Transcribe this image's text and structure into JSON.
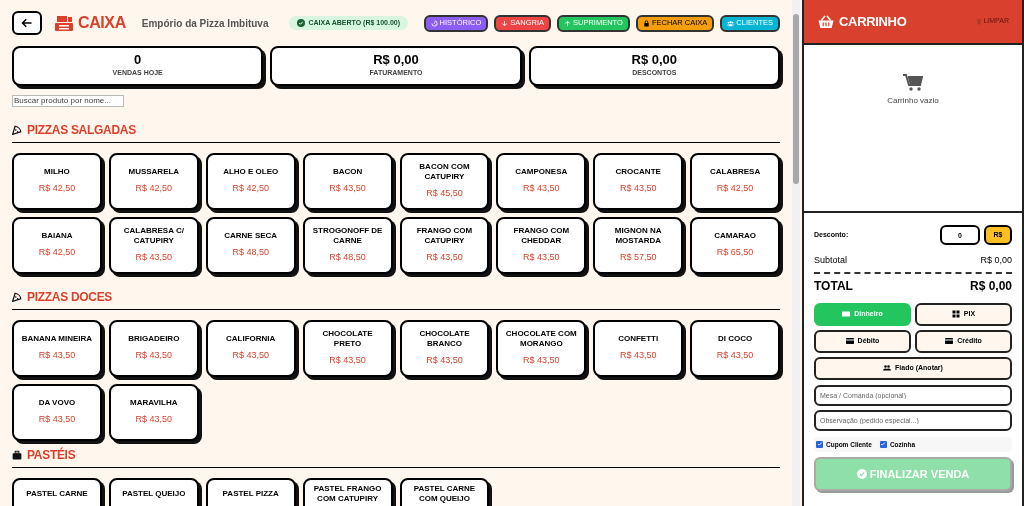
{
  "header": {
    "logo": "CAIXA",
    "store_name": "Empório da Pizza Imbituva",
    "status_badge": "CAIXA ABERTO (R$ 100.00)",
    "buttons": [
      {
        "label": "HISTÓRICO",
        "kind": "history",
        "color": "#8b5cf6"
      },
      {
        "label": "SANGRIA",
        "kind": "down",
        "color": "#ef4444"
      },
      {
        "label": "SUPRIMENTO",
        "kind": "up",
        "color": "#22c55e"
      },
      {
        "label": "FECHAR CAIXA",
        "kind": "lock",
        "color": "#f59e0b"
      },
      {
        "label": "CLIENTES",
        "kind": "users",
        "color": "#06b6d4"
      }
    ]
  },
  "stats": [
    {
      "value": "0",
      "label": "VENDAS HOJE"
    },
    {
      "value": "R$ 0,00",
      "label": "FATURAMENTO"
    },
    {
      "value": "R$ 0,00",
      "label": "DESCONTOS"
    }
  ],
  "search": {
    "placeholder": "Buscar produto por nome..."
  },
  "categories": [
    {
      "title": "PIZZAS SALGADAS",
      "kind": "slice",
      "products": [
        {
          "name": "MILHO",
          "price": "R$ 42,50"
        },
        {
          "name": "MUSSARELA",
          "price": "R$ 42,50"
        },
        {
          "name": "ALHO E OLEO",
          "price": "R$ 42,50"
        },
        {
          "name": "BACON",
          "price": "R$ 43,50"
        },
        {
          "name": "BACON COM CATUPIRY",
          "price": "R$ 45,50"
        },
        {
          "name": "CAMPONESA",
          "price": "R$ 43,50"
        },
        {
          "name": "CROCANTE",
          "price": "R$ 43,50"
        },
        {
          "name": "CALABRESA",
          "price": "R$ 42,50"
        },
        {
          "name": "BAIANA",
          "price": "R$ 42,50"
        },
        {
          "name": "CALABRESA C/ CATUPIRY",
          "price": "R$ 43,50"
        },
        {
          "name": "CARNE SECA",
          "price": "R$ 48,50"
        },
        {
          "name": "STROGONOFF DE CARNE",
          "price": "R$ 48,50"
        },
        {
          "name": "FRANGO COM CATUPIRY",
          "price": "R$ 43,50"
        },
        {
          "name": "FRANGO COM CHEDDAR",
          "price": "R$ 43,50"
        },
        {
          "name": "MIGNON NA MOSTARDA",
          "price": "R$ 57,50"
        },
        {
          "name": "CAMARAO",
          "price": "R$ 65,50"
        }
      ]
    },
    {
      "title": "PIZZAS DOCES",
      "kind": "slice",
      "products": [
        {
          "name": "BANANA MINEIRA",
          "price": "R$ 43,50"
        },
        {
          "name": "BRIGADEIRO",
          "price": "R$ 43,50"
        },
        {
          "name": "CALIFORNIA",
          "price": "R$ 43,50"
        },
        {
          "name": "CHOCOLATE PRETO",
          "price": "R$ 43,50"
        },
        {
          "name": "CHOCOLATE BRANCO",
          "price": "R$ 43,50"
        },
        {
          "name": "CHOCOLATE COM MORANGO",
          "price": "R$ 43,50"
        },
        {
          "name": "CONFETTI",
          "price": "R$ 43,50"
        },
        {
          "name": "DI COCO",
          "price": "R$ 43,50"
        },
        {
          "name": "DA VOVO",
          "price": "R$ 43,50"
        },
        {
          "name": "MARAVILHA",
          "price": "R$ 43,50"
        }
      ]
    },
    {
      "title": "PASTÉIS",
      "kind": "box",
      "products": [
        {
          "name": "PASTEL CARNE"
        },
        {
          "name": "PASTEL QUEIJO"
        },
        {
          "name": "PASTEL PIZZA"
        },
        {
          "name": "PASTEL FRANGO COM CATUPIRY"
        },
        {
          "name": "PASTEL CARNE COM QUEIJO"
        }
      ]
    }
  ],
  "cart": {
    "title": "CARRINHO",
    "clear_label": "LIMPAR",
    "empty_text": "Carrinho vazio",
    "discount": {
      "label": "Desconto:",
      "value": "0",
      "unit": "R$"
    },
    "subtotal": {
      "label": "Subtotal",
      "value": "R$ 0,00"
    },
    "total": {
      "label": "TOTAL",
      "value": "R$ 0,00"
    },
    "payments": [
      {
        "label": "Dinheiro",
        "kind": "cash",
        "selected": true
      },
      {
        "label": "PIX",
        "kind": "pix",
        "selected": false
      },
      {
        "label": "Débito",
        "kind": "card",
        "selected": false
      },
      {
        "label": "Crédito",
        "kind": "card",
        "selected": false
      },
      {
        "label": "Fiado (Anotar)",
        "kind": "people",
        "selected": false
      }
    ],
    "table_field": {
      "placeholder": "Mesa / Comanda (opcional)"
    },
    "note_field": {
      "placeholder": "Observação (pedido especial...)"
    },
    "options": [
      {
        "label": "Cupom Cliente",
        "checked": true
      },
      {
        "label": "Cozinha",
        "checked": true
      }
    ],
    "finalize_label": "FINALIZAR VENDA"
  }
}
